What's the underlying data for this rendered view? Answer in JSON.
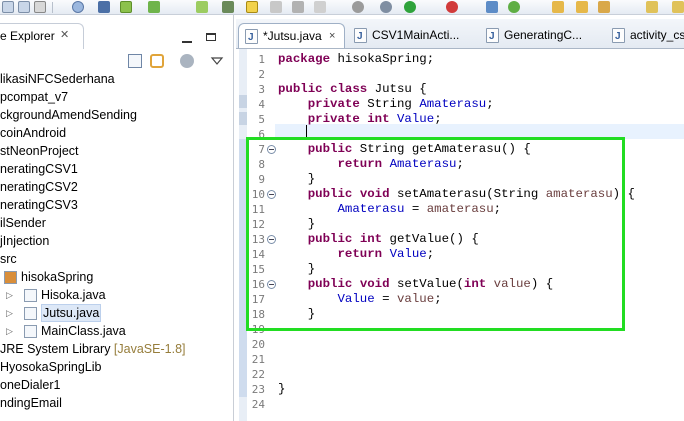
{
  "left_panel": {
    "tab_label": "e Explorer",
    "tree": [
      {
        "label": "likasiNFCSederhana",
        "indent": 0,
        "icon": "project"
      },
      {
        "label": "pcompat_v7",
        "indent": 0,
        "icon": "project"
      },
      {
        "label": "ckgroundAmendSending",
        "indent": 0,
        "icon": "project"
      },
      {
        "label": "coinAndroid",
        "indent": 0,
        "icon": "project"
      },
      {
        "label": "stNeonProject",
        "indent": 0,
        "icon": "project"
      },
      {
        "label": "neratingCSV1",
        "indent": 0,
        "icon": "project"
      },
      {
        "label": "neratingCSV2",
        "indent": 0,
        "icon": "project"
      },
      {
        "label": "neratingCSV3",
        "indent": 0,
        "icon": "project"
      },
      {
        "label": "ilSender",
        "indent": 0,
        "icon": "project"
      },
      {
        "label": "jInjection",
        "indent": 0,
        "icon": "project"
      },
      {
        "label": "src",
        "indent": 0,
        "icon": "folder"
      },
      {
        "label": "hisokaSpring",
        "indent": 1,
        "icon": "package"
      },
      {
        "label": "Hisoka.java",
        "indent": 2,
        "icon": "java"
      },
      {
        "label": "Jutsu.java",
        "indent": 2,
        "icon": "java"
      },
      {
        "label": "MainClass.java",
        "indent": 2,
        "icon": "java"
      },
      {
        "label": "JRE System Library",
        "decor": "[JavaSE-1.8]",
        "indent": 0,
        "icon": "library"
      },
      {
        "label": "HyosokaSpringLib",
        "indent": 0,
        "icon": "library"
      },
      {
        "label": "oneDialer1",
        "indent": 0,
        "icon": "project"
      },
      {
        "label": "ndingEmail",
        "indent": 0,
        "icon": "project"
      },
      {
        "label": "",
        "indent": 0,
        "icon": "project"
      }
    ]
  },
  "editor_tabs": [
    {
      "label": "*Jutsu.java",
      "active": true,
      "close": "×"
    },
    {
      "label": "CSV1MainActi...",
      "active": false
    },
    {
      "label": "GeneratingC...",
      "active": false
    },
    {
      "label": "activity_cs",
      "active": false
    }
  ],
  "editor": {
    "line_numbers": [
      "1",
      "2",
      "3",
      "4",
      "5",
      "6",
      "7",
      "8",
      "9",
      "10",
      "11",
      "12",
      "13",
      "14",
      "15",
      "16",
      "17",
      "18",
      "19",
      "20",
      "21",
      "22",
      "23",
      "24"
    ],
    "lines": [
      "package hisokaSpring;",
      "",
      "public class Jutsu {",
      "    private String Amaterasu;",
      "    private int Value;",
      "",
      "    public String getAmaterasu() {",
      "        return Amaterasu;",
      "    }",
      "    public void setAmaterasu(String amaterasu) {",
      "        Amaterasu = amaterasu;",
      "    }",
      "    public int getValue() {",
      "        return Value;",
      "    }",
      "    public void setValue(int value) {",
      "        Value = value;",
      "    }",
      "",
      "",
      "",
      "",
      "}",
      ""
    ]
  },
  "colors": {
    "keyword": "#7f0055",
    "field": "#0000c0",
    "parameter": "#6a3e3e",
    "highlight_box": "#22dd22"
  }
}
